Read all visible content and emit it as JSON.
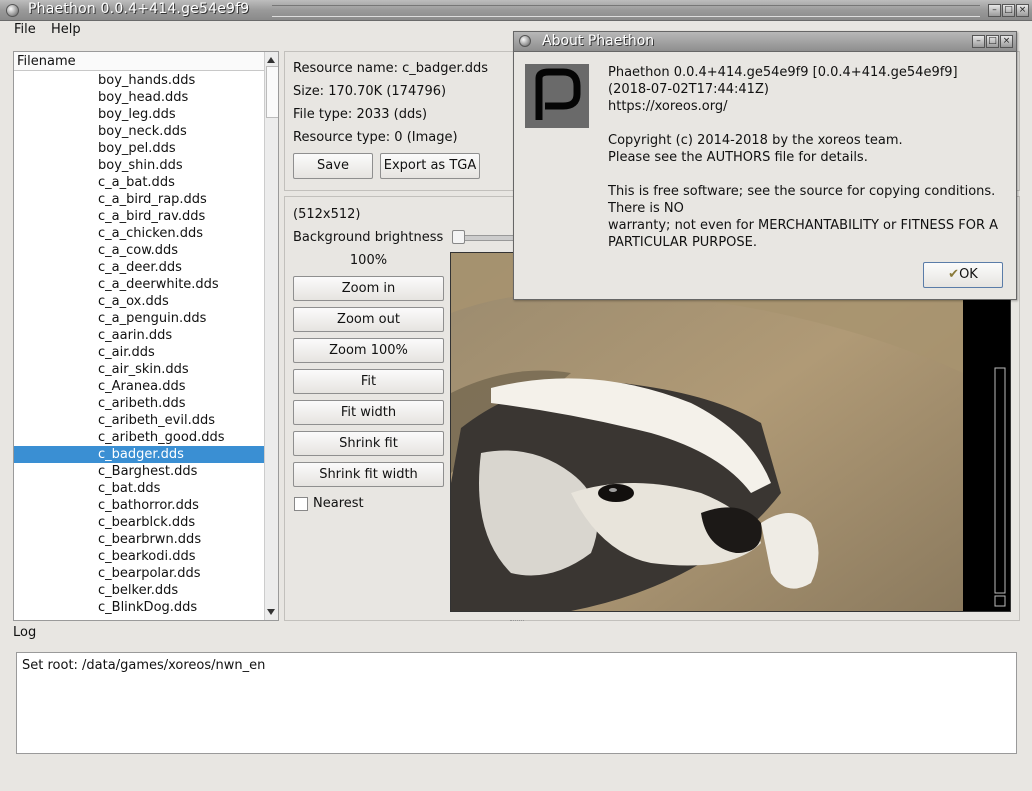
{
  "window": {
    "title": "Phaethon 0.0.4+414.ge54e9f9"
  },
  "menu": {
    "file": "File",
    "help": "Help"
  },
  "filelist": {
    "header": "Filename",
    "items": [
      {
        "name": "boy_hands.dds"
      },
      {
        "name": "boy_head.dds"
      },
      {
        "name": "boy_leg.dds"
      },
      {
        "name": "boy_neck.dds"
      },
      {
        "name": "boy_pel.dds"
      },
      {
        "name": "boy_shin.dds"
      },
      {
        "name": "c_a_bat.dds"
      },
      {
        "name": "c_a_bird_rap.dds"
      },
      {
        "name": "c_a_bird_rav.dds"
      },
      {
        "name": "c_a_chicken.dds"
      },
      {
        "name": "c_a_cow.dds"
      },
      {
        "name": "c_a_deer.dds"
      },
      {
        "name": "c_a_deerwhite.dds"
      },
      {
        "name": "c_a_ox.dds"
      },
      {
        "name": "c_a_penguin.dds"
      },
      {
        "name": "c_aarin.dds"
      },
      {
        "name": "c_air.dds"
      },
      {
        "name": "c_air_skin.dds"
      },
      {
        "name": "c_Aranea.dds"
      },
      {
        "name": "c_aribeth.dds"
      },
      {
        "name": "c_aribeth_evil.dds"
      },
      {
        "name": "c_aribeth_good.dds"
      },
      {
        "name": "c_badger.dds",
        "selected": true
      },
      {
        "name": "c_Barghest.dds"
      },
      {
        "name": "c_bat.dds"
      },
      {
        "name": "c_bathorror.dds"
      },
      {
        "name": "c_bearblck.dds"
      },
      {
        "name": "c_bearbrwn.dds"
      },
      {
        "name": "c_bearkodi.dds"
      },
      {
        "name": "c_bearpolar.dds"
      },
      {
        "name": "c_belker.dds"
      },
      {
        "name": "c_BlinkDog.dds"
      }
    ]
  },
  "info": {
    "resource_name": "Resource name: c_badger.dds",
    "size": "Size: 170.70K (174796)",
    "file_type": "File type: 2033 (dds)",
    "resource_type": "Resource type: 0 (Image)",
    "save": "Save",
    "export": "Export as TGA"
  },
  "preview": {
    "dimensions": "(512x512)",
    "bg_label": "Background brightness",
    "zoom": "100%",
    "buttons": [
      "Zoom in",
      "Zoom out",
      "Zoom 100%",
      "Fit",
      "Fit width",
      "Shrink fit",
      "Shrink fit width"
    ],
    "nearest": "Nearest"
  },
  "log": {
    "label": "Log",
    "text": "Set root: /data/games/xoreos/nwn_en"
  },
  "about": {
    "title": "About Phaethon",
    "text": "Phaethon 0.0.4+414.ge54e9f9 [0.0.4+414.ge54e9f9]\n(2018-07-02T17:44:41Z)\nhttps://xoreos.org/\n\nCopyright (c) 2014-2018 by the xoreos team.\nPlease see the AUTHORS file for details.\n\nThis is free software; see the source for copying conditions.\nThere is NO\nwarranty; not even for MERCHANTABILITY or FITNESS FOR A\nPARTICULAR PURPOSE.",
    "ok": "OK"
  }
}
